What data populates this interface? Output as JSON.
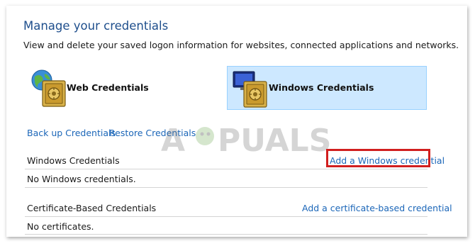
{
  "page": {
    "title": "Manage your credentials",
    "subtitle": "View and delete your saved logon information for websites, connected applications and networks."
  },
  "tiles": {
    "web": {
      "label": "Web Credentials",
      "icon": "web-vault-icon",
      "selected": false
    },
    "windows": {
      "label": "Windows Credentials",
      "icon": "windows-vault-icon",
      "selected": true
    }
  },
  "actions": {
    "backup_label": "Back up Credentials",
    "restore_label": "Restore Credentials"
  },
  "sections": {
    "windows": {
      "title": "Windows Credentials",
      "add_label": "Add a Windows credential",
      "empty_text": "No Windows credentials."
    },
    "certificate": {
      "title": "Certificate-Based Credentials",
      "add_label": "Add a certificate-based credential",
      "empty_text": "No certificates."
    }
  },
  "watermark": {
    "text": "APPUALS"
  },
  "colors": {
    "title": "#1e4e8c",
    "link": "#1b66b8",
    "selected_tile_bg": "#cde8ff",
    "highlight_box": "#d11f1f"
  }
}
